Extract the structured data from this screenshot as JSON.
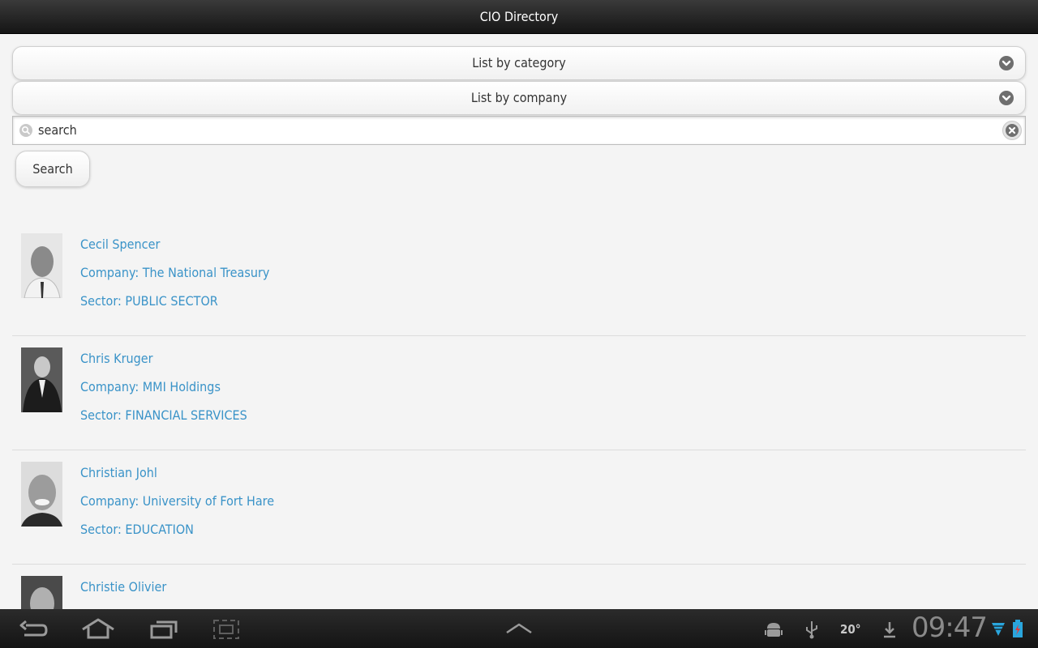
{
  "app": {
    "title": "CIO Directory"
  },
  "filters": {
    "category_label": "List by category",
    "company_label": "List by company"
  },
  "search": {
    "placeholder": "search",
    "value": "",
    "button_label": "Search"
  },
  "people": [
    {
      "name": "Cecil Spencer",
      "company": "Company: The National Treasury",
      "sector": "Sector: PUBLIC SECTOR"
    },
    {
      "name": "Chris Kruger",
      "company": "Company: MMI Holdings",
      "sector": "Sector: FINANCIAL SERVICES"
    },
    {
      "name": "Christian Johl",
      "company": "Company: University of Fort Hare",
      "sector": "Sector: EDUCATION"
    },
    {
      "name": "Christie Olivier",
      "company": "",
      "sector": ""
    }
  ],
  "colors": {
    "link": "#3a93c8",
    "titlebar": "#1e1e1e",
    "background": "#f4f4f4"
  },
  "system_bar": {
    "icons": [
      "back-icon",
      "home-icon",
      "recent-apps-icon",
      "screenshot-icon",
      "chevron-up-icon",
      "android-debug-icon",
      "usb-icon",
      "download-icon",
      "wifi-icon",
      "battery-icon"
    ],
    "temperature": "20°",
    "time": "09:47"
  }
}
